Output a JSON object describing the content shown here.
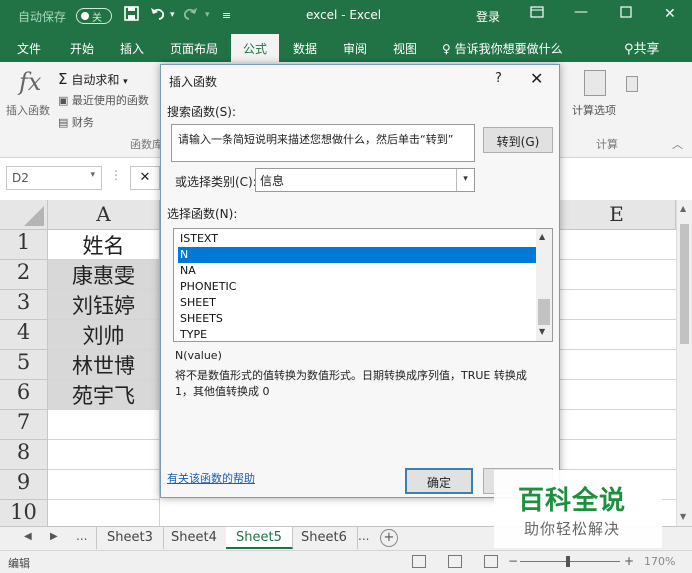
{
  "titlebar": {
    "autosave": "自动保存",
    "autosave_state": "关",
    "save_icon": "save-icon",
    "undo_icon": "undo-icon",
    "redo_icon": "redo-icon",
    "title": "excel  -  Excel",
    "login": "登录",
    "ribbon_display_icon": "ribbon-display-icon"
  },
  "tabs": [
    "文件",
    "开始",
    "插入",
    "页面布局",
    "公式",
    "数据",
    "审阅",
    "视图"
  ],
  "active_tab": "公式",
  "tell_me": "告诉我你想要做什么",
  "share": "共享",
  "ribbon": {
    "insert_function": "插入函数",
    "autosum": "自动求和",
    "recent": "最近使用的函数",
    "financial": "财务",
    "function_library": "函数库",
    "calc_options": "计算选项",
    "calculation": "计算"
  },
  "formula_bar": {
    "name_box": "D2",
    "cancel": "✕"
  },
  "columns": {
    "a": "A",
    "e": "E"
  },
  "rows": [
    "1",
    "2",
    "3",
    "4",
    "5",
    "6",
    "7",
    "8",
    "9",
    "10"
  ],
  "cells": [
    "姓名",
    "康惠雯",
    "刘钰婷",
    "刘帅",
    "林世博",
    "苑宇飞"
  ],
  "sheet_tabs": [
    "Sheet3",
    "Sheet4",
    "Sheet5",
    "Sheet6"
  ],
  "active_sheet": "Sheet5",
  "sheet_more": "...",
  "status": {
    "mode": "编辑",
    "zoom_minus": "−",
    "zoom_plus": "+",
    "zoom": "170%"
  },
  "dialog": {
    "title": "插入函数",
    "help": "?",
    "close": "✕",
    "search_label": "搜索函数(S):",
    "search_text": "请输入一条简短说明来描述您想做什么，然后单击“转到”",
    "go": "转到(G)",
    "category_label": "或选择类别(C):",
    "category": "信息",
    "select_label": "选择函数(N):",
    "functions": [
      "ISTEXT",
      "N",
      "NA",
      "PHONETIC",
      "SHEET",
      "SHEETS",
      "TYPE"
    ],
    "selected_function": "N",
    "signature": "N(value)",
    "description": "将不是数值形式的值转换为数值形式。日期转换成序列值，TRUE 转换成 1，其他值转换成 0",
    "help_link": "有关该函数的帮助",
    "ok": "确定"
  },
  "watermark": {
    "title": "百科全说",
    "subtitle": "助你轻松解决"
  }
}
